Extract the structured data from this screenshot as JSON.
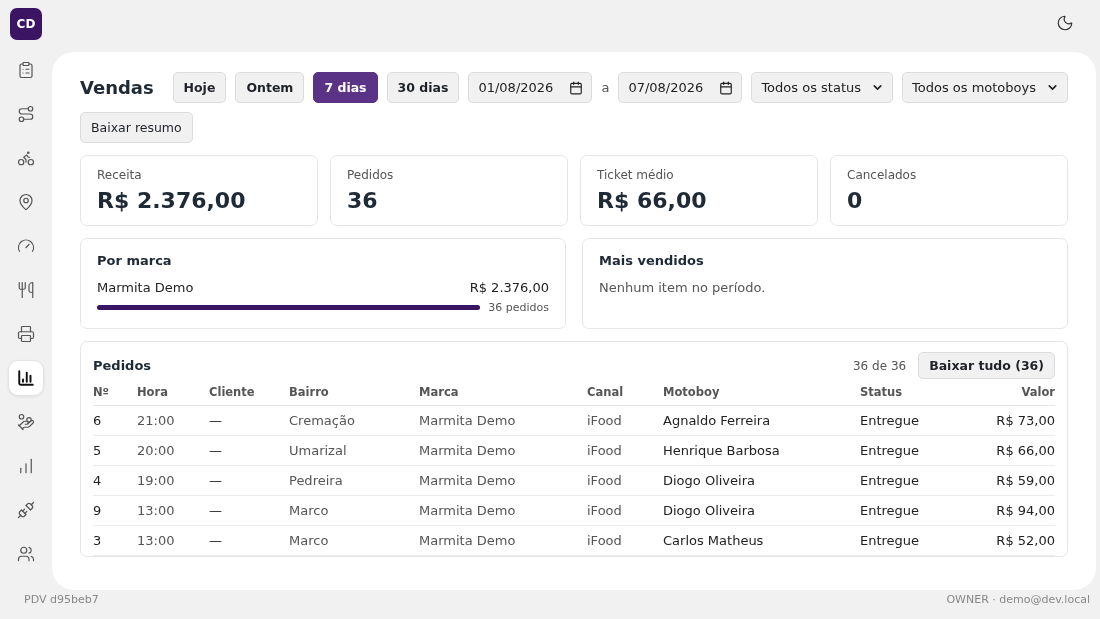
{
  "logo": "CD",
  "sidebar": {
    "items": [
      {
        "selected": false
      },
      {
        "selected": false
      },
      {
        "selected": false
      },
      {
        "selected": false
      },
      {
        "selected": false
      },
      {
        "selected": false
      },
      {
        "selected": false
      },
      {
        "selected": true
      },
      {
        "selected": false
      },
      {
        "selected": false
      },
      {
        "selected": false
      },
      {
        "selected": false
      }
    ]
  },
  "title": "Vendas",
  "ranges": [
    {
      "label": "Hoje",
      "selected": false
    },
    {
      "label": "Ontem",
      "selected": false
    },
    {
      "label": "7 dias",
      "selected": true
    },
    {
      "label": "30 dias",
      "selected": false
    }
  ],
  "date_from": "01/08/2026",
  "date_sep": "a",
  "date_to": "07/08/2026",
  "filters": [
    "Todos os status",
    "Todos os motoboys"
  ],
  "download_summary": "Baixar resumo",
  "kpis": [
    {
      "label": "Receita",
      "value": "R$ 2.376,00"
    },
    {
      "label": "Pedidos",
      "value": "36"
    },
    {
      "label": "Ticket médio",
      "value": "R$ 66,00"
    },
    {
      "label": "Cancelados",
      "value": "0"
    }
  ],
  "by_brand": {
    "title": "Por marca",
    "items": [
      {
        "name": "Marmita Demo",
        "amount": "R$ 2.376,00",
        "count": "36 pedidos",
        "level": 1
      }
    ]
  },
  "best_sellers": {
    "title": "Mais vendidos",
    "empty": "Nenhum item no período."
  },
  "orders": {
    "title": "Pedidos",
    "count": "36 de 36",
    "download": "Baixar tudo (36)",
    "columns": [
      "Nº",
      "Hora",
      "Cliente",
      "Bairro",
      "Marca",
      "Canal",
      "Motoboy",
      "Status",
      "Valor"
    ],
    "rows": [
      [
        "6",
        "21:00",
        "—",
        "Cremação",
        "Marmita Demo",
        "iFood",
        "Agnaldo Ferreira",
        "Entregue",
        "R$ 73,00"
      ],
      [
        "5",
        "20:00",
        "—",
        "Umarizal",
        "Marmita Demo",
        "iFood",
        "Henrique Barbosa",
        "Entregue",
        "R$ 66,00"
      ],
      [
        "4",
        "19:00",
        "—",
        "Pedreira",
        "Marmita Demo",
        "iFood",
        "Diogo Oliveira",
        "Entregue",
        "R$ 59,00"
      ],
      [
        "9",
        "13:00",
        "—",
        "Marco",
        "Marmita Demo",
        "iFood",
        "Diogo Oliveira",
        "Entregue",
        "R$ 94,00"
      ],
      [
        "3",
        "13:00",
        "—",
        "Marco",
        "Marmita Demo",
        "iFood",
        "Carlos Matheus",
        "Entregue",
        "R$ 52,00"
      ]
    ]
  },
  "footer": {
    "left": "PDV d95beb7",
    "right": "OWNER · demo@dev.local"
  }
}
